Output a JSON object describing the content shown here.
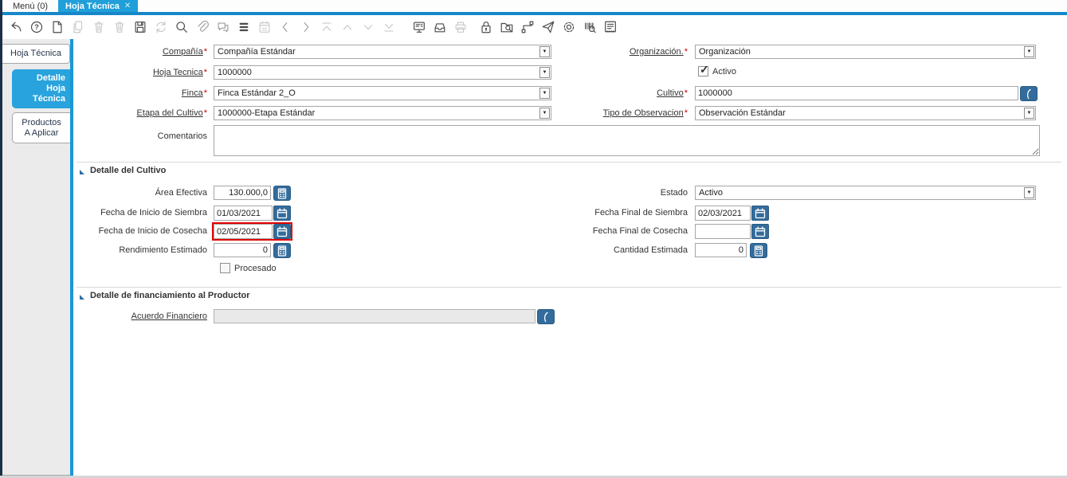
{
  "colors": {
    "accent_blue": "#219fd9",
    "strip_blue": "#1787c9",
    "rail_blue": "#1b97d4",
    "button_blue": "#336c9c",
    "sidebar_selected_blue": "#29a3dd",
    "highlight_red": "#e10000",
    "sidebar_bg": "#ebebeb"
  },
  "tabbar": {
    "tabs": [
      {
        "label": "Menú (0)",
        "active": false
      },
      {
        "label": "Hoja Técnica",
        "active": true,
        "close_icon": "✕"
      }
    ]
  },
  "toolbar": {
    "icons": [
      {
        "name": "undo",
        "state": "enabled"
      },
      {
        "name": "help",
        "state": "enabled"
      },
      {
        "name": "new-record",
        "state": "enabled"
      },
      {
        "name": "copy-record",
        "state": "disabled"
      },
      {
        "name": "delete-record",
        "state": "disabled"
      },
      {
        "name": "delete-selection",
        "state": "disabled"
      },
      {
        "name": "save",
        "state": "enabled"
      },
      {
        "name": "requery",
        "state": "disabled"
      },
      {
        "name": "find",
        "state": "enabled"
      },
      {
        "name": "attachment",
        "state": "dimmed"
      },
      {
        "name": "chat",
        "state": "dimmed"
      },
      {
        "name": "grid-toggle",
        "state": "enabled"
      },
      {
        "name": "calendar",
        "state": "disabled"
      },
      {
        "name": "nav-left",
        "state": "dimmed"
      },
      {
        "name": "nav-right",
        "state": "dimmed"
      },
      {
        "name": "first-record",
        "state": "disabled"
      },
      {
        "name": "previous-record",
        "state": "disabled"
      },
      {
        "name": "next-record",
        "state": "disabled"
      },
      {
        "name": "last-record",
        "state": "disabled"
      },
      {
        "name": "report",
        "state": "enabled"
      },
      {
        "name": "archive",
        "state": "enabled"
      },
      {
        "name": "print",
        "state": "disabled"
      },
      {
        "name": "lock",
        "state": "enabled"
      },
      {
        "name": "zoom-across",
        "state": "enabled"
      },
      {
        "name": "workflow",
        "state": "enabled"
      },
      {
        "name": "share",
        "state": "enabled"
      },
      {
        "name": "preferences",
        "state": "enabled"
      },
      {
        "name": "product-info",
        "state": "enabled"
      },
      {
        "name": "window-report",
        "state": "enabled"
      }
    ]
  },
  "sidebar": {
    "tabs": [
      {
        "label": "Hoja Técnica",
        "selected": false
      },
      {
        "label": "Detalle Hoja Técnica",
        "lines": [
          "Detalle",
          "Hoja",
          "Técnica"
        ],
        "selected": true
      },
      {
        "label": "Productos A Aplicar",
        "lines": [
          "Productos",
          "A Aplicar"
        ],
        "selected": false
      }
    ]
  },
  "form": {
    "compania": {
      "label": "Compañía",
      "required": "*",
      "value": "Compañía Estándar"
    },
    "organizacion": {
      "label": "Organización.",
      "required": "*",
      "value": "Organización"
    },
    "hoja_tecnica": {
      "label": "Hoja Tecnica",
      "required": "*",
      "value": "1000000"
    },
    "activo": {
      "label": "Activo",
      "checked": true
    },
    "finca": {
      "label": "Finca",
      "required": "*",
      "value": "Finca Estándar 2_O"
    },
    "cultivo": {
      "label": "Cultivo",
      "required": "*",
      "value": "1000000"
    },
    "etapa_cultivo": {
      "label": "Etapa del Cultivo",
      "required": "*",
      "value": "1000000-Etapa Estándar"
    },
    "tipo_observacion": {
      "label": "Tipo de Observacion",
      "required": "*",
      "value": "Observación Estándar"
    },
    "comentarios": {
      "label": "Comentarios",
      "value": ""
    },
    "seccion_cultivo": {
      "title": "Detalle del Cultivo"
    },
    "area_efectiva": {
      "label": "Área Efectiva",
      "value": "130.000,0"
    },
    "estado": {
      "label": "Estado",
      "value": "Activo"
    },
    "fecha_inicio_siembra": {
      "label": "Fecha de Inicio de Siembra",
      "value": "01/03/2021"
    },
    "fecha_final_siembra": {
      "label": "Fecha Final de Siembra",
      "value": "02/03/2021"
    },
    "fecha_inicio_cosecha": {
      "label": "Fecha de Inicio de Cosecha",
      "value": "02/05/2021",
      "highlighted": true
    },
    "fecha_final_cosecha": {
      "label": "Fecha Final de Cosecha",
      "value": ""
    },
    "rendimiento_estimado": {
      "label": "Rendimiento Estimado",
      "value": "0"
    },
    "cantidad_estimada": {
      "label": "Cantidad Estimada",
      "value": "0"
    },
    "procesado": {
      "label": "Procesado",
      "checked": false
    },
    "seccion_financiamiento": {
      "title": "Detalle de financiamiento al Productor"
    },
    "acuerdo_financiero": {
      "label": "Acuerdo Financiero",
      "value": ""
    }
  }
}
